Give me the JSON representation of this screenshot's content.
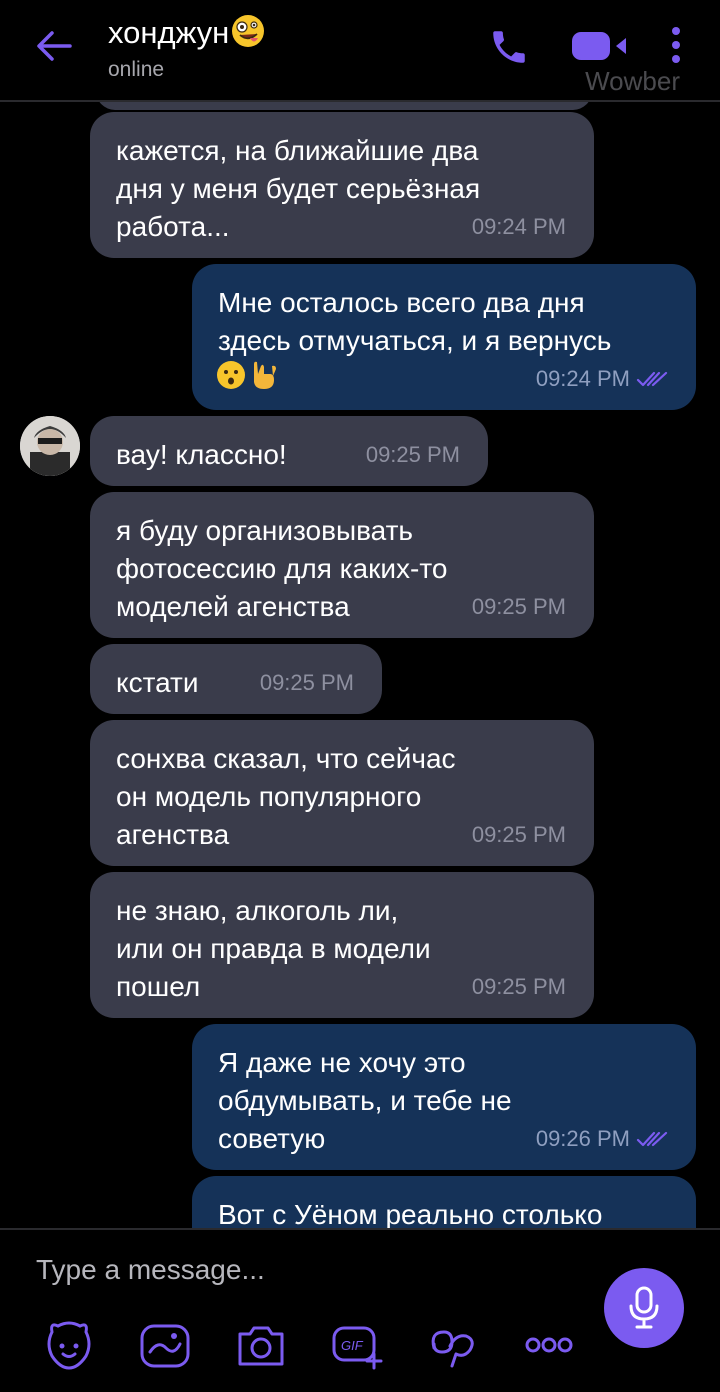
{
  "header": {
    "contact_name": "хонджун",
    "status": "online",
    "watermark": "Wowber",
    "icons": [
      "back-arrow-icon",
      "phone-icon",
      "video-call-icon",
      "more-options-icon"
    ]
  },
  "messages": [
    {
      "dir": "in",
      "text": "кажется, на ближайшие два\nдня у меня будет серьёзная\nработа...",
      "time": "09:24 PM"
    },
    {
      "dir": "out",
      "text": "Мне осталось всего два дня\nздесь отмучаться, и я вернусь",
      "emojis": [
        "hushed-face-emoji",
        "rock-on-hand-emoji"
      ],
      "time": "09:24 PM",
      "read": true
    },
    {
      "dir": "in",
      "text": "вау! классно!",
      "time": "09:25 PM",
      "avatar": true
    },
    {
      "dir": "in",
      "text": "я буду организовывать\nфотосессию для каких-то\nмоделей агенства",
      "time": "09:25 PM"
    },
    {
      "dir": "in",
      "text": "кстати",
      "time": "09:25 PM"
    },
    {
      "dir": "in",
      "text": "сонхва сказал, что сейчас\nон модель популярного\nагенства",
      "time": "09:25 PM"
    },
    {
      "dir": "in",
      "text": "не знаю, алкоголь ли,\nили он правда в модели\nпошел",
      "time": "09:25 PM"
    },
    {
      "dir": "out",
      "text": "Я даже не хочу это\nобдумывать, и тебе не\nсоветую",
      "time": "09:26 PM",
      "read": true
    },
    {
      "dir": "out",
      "text": "Вот с Уёном реально столько",
      "time": ""
    }
  ],
  "composer": {
    "placeholder": "Type a message...",
    "gif_label": "GIF",
    "tools": [
      "sticker-icon",
      "doodle-icon",
      "camera-icon",
      "gif-icon",
      "gallery-icon",
      "more-icon"
    ],
    "send_icon": "microphone-icon"
  },
  "colors": {
    "accent": "#7b5bf0",
    "incoming_bubble": "#3a3c4b",
    "outgoing_bubble": "#153258",
    "background": "#000000"
  }
}
